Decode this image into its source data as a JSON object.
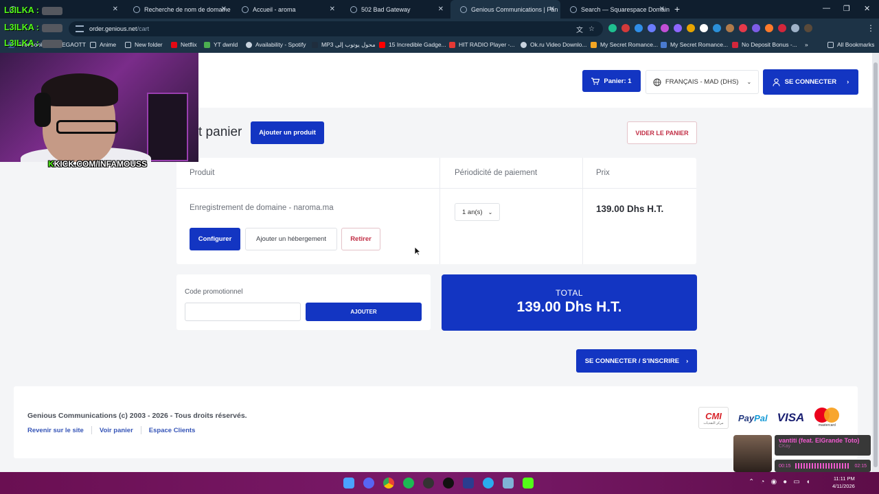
{
  "browser": {
    "tabs": [
      {
        "label": "",
        "active": false
      },
      {
        "label": "Recherche de nom de domaine",
        "active": false
      },
      {
        "label": "Accueil - aroma",
        "active": false
      },
      {
        "label": "502 Bad Gateway",
        "active": false
      },
      {
        "label": "Genious Communications | Pan",
        "active": true
      },
      {
        "label": "Search — Squarespace Domain",
        "active": false
      }
    ],
    "url_host": "order.genious.net",
    "url_path": "/cart",
    "bookmarks": [
      "Facebook",
      "EGAOTT",
      "Anime",
      "New folder",
      "Netflix",
      "YT dwnld",
      "Availability - Spotify",
      "MP3 محول يوتوب إلى",
      "15 Incredible Gadge...",
      "HIT RADIO Player -...",
      "Ok.ru Video Downlo...",
      "My Secret Romance...",
      "My Secret Romance...",
      "No Deposit Bonus -...",
      "All Bookmarks"
    ]
  },
  "header": {
    "cart_label": "Panier: 1",
    "language_label": "FRANÇAIS - MAD (DHS)",
    "login_label": "SE CONNECTER"
  },
  "cart": {
    "title": "t panier",
    "add_product_label": "Ajouter un produit",
    "empty_cart_label": "VIDER LE PANIER",
    "columns": {
      "product": "Produit",
      "period": "Périodicité de paiement",
      "price": "Prix"
    },
    "item": {
      "name": "Enregistrement de domaine - naroma.ma",
      "configure_label": "Configurer",
      "hosting_label": "Ajouter un hébergement",
      "remove_label": "Retirer",
      "period_value": "1 an(s)",
      "price": "139.00 Dhs H.T."
    }
  },
  "promo": {
    "label": "Code promotionnel",
    "value": "",
    "apply_label": "AJOUTER"
  },
  "total": {
    "label": "TOTAL",
    "value": "139.00 Dhs H.T."
  },
  "checkout_label": "SE CONNECTER / S'INSCRIRE",
  "footer": {
    "copyright": "Genious Communications (c) 2003 - 2026 - Tous droits réservés.",
    "links": [
      "Revenir sur le site",
      "Voir panier",
      "Espace Clients"
    ],
    "payments": {
      "cmi": "CMI",
      "cmi_sub": "مركز النقديات",
      "paypal_a": "Pay",
      "paypal_b": "Pal",
      "visa": "VISA",
      "mastercard": "mastercard"
    }
  },
  "overlay": {
    "chat_lines": [
      "L3ILKA :",
      "L3ILKA :",
      "L3ILKA :"
    ],
    "kick_prefix": "K",
    "kick_text": "KICK.COM/INFAMOUSS",
    "song_title": "vantiti (feat. ElGrande Toto)",
    "song_artist": "CKay",
    "song_elapsed": "00:15",
    "song_total": "02:15"
  },
  "taskbar": {
    "time": "11:11 PM",
    "date": "4/11/2026"
  },
  "colors": {
    "brand_blue": "#1335c2",
    "danger_red": "#c12d44",
    "kick_green": "#53fc18"
  }
}
